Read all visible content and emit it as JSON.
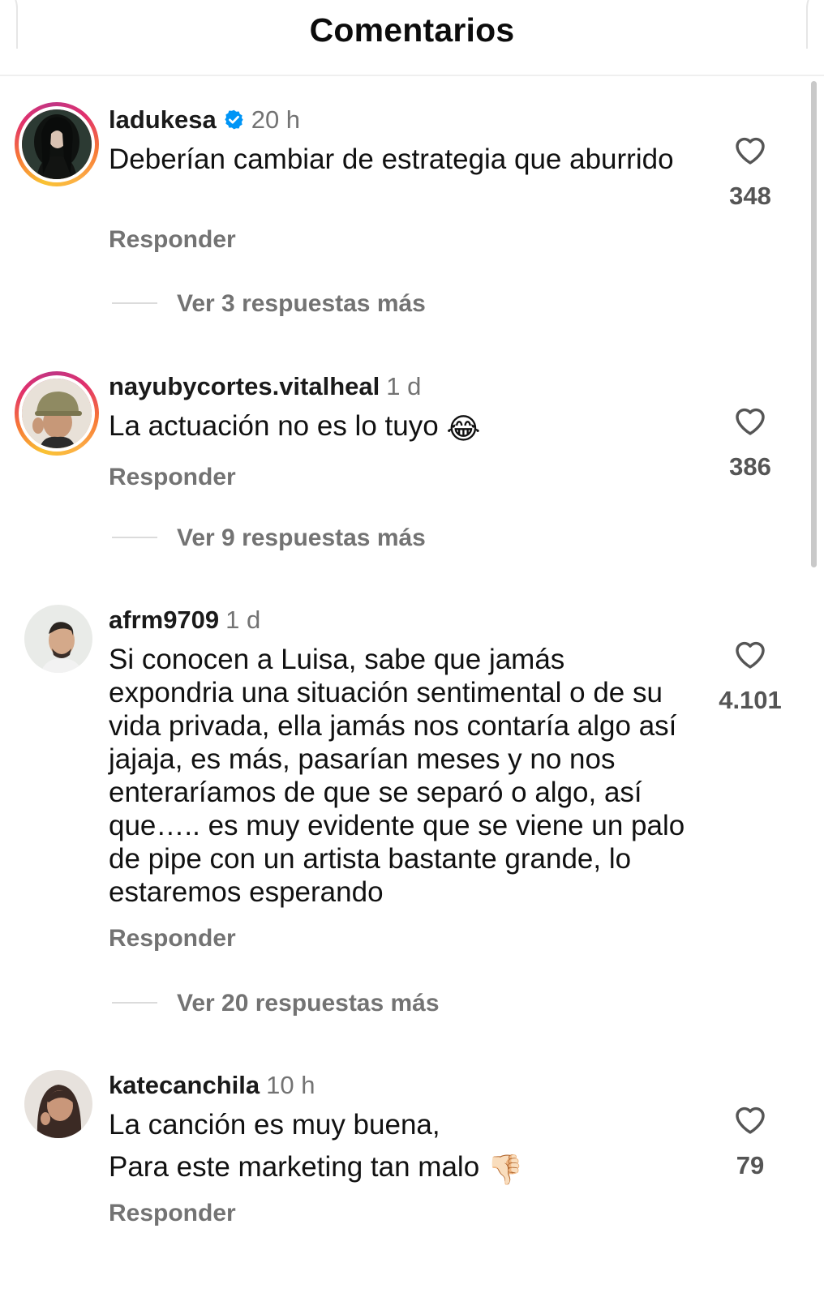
{
  "header": {
    "title": "Comentarios"
  },
  "comments": [
    {
      "username": "ladukesa",
      "verified": true,
      "time": "20 h",
      "text": "Deberían cambiar de estrategia que aburrido",
      "likes": "348",
      "reply_label": "Responder",
      "more_replies": "Ver 3 respuestas más"
    },
    {
      "username": "nayubycortes.vitalheal",
      "verified": false,
      "time": "1 d",
      "text": "La actuación no es lo tuyo",
      "emoji": "😂",
      "likes": "386",
      "reply_label": "Responder",
      "more_replies": "Ver 9 respuestas más"
    },
    {
      "username": "afrm9709",
      "verified": false,
      "time": "1 d",
      "text": "Si conocen a Luisa, sabe que jamás expondria una situación sentimental o de su vida privada, ella jamás nos contaría algo así jajaja, es más, pasarían meses y no nos enteraríamos de que se separó o algo, así que….. es muy evidente que se viene un palo de pipe con un artista bastante grande, lo estaremos esperando",
      "likes": "4.101",
      "reply_label": "Responder",
      "more_replies": "Ver 20 respuestas más"
    },
    {
      "username": "katecanchila",
      "verified": false,
      "time": "10 h",
      "text_line1": "La canción es muy buena,",
      "text_line2": "Para este marketing tan malo",
      "emoji": "👎🏻",
      "likes": "79",
      "reply_label": "Responder"
    }
  ],
  "icons": {
    "like": "heart-outline-icon",
    "verified": "verified-badge-icon"
  },
  "colors": {
    "verified": "#0095f6",
    "secondary_text": "#737373"
  }
}
